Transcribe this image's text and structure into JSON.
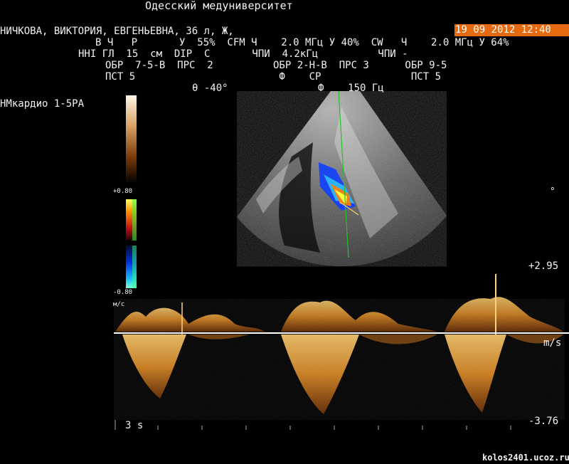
{
  "header": {
    "clinic": "Одесский медуниверситет",
    "patient": "НИЧКОВА, ВИКТОРИЯ, ЕВГЕНЬЕВНА, 36 л, Ж,",
    "datetime": "19 09 2012 12:40"
  },
  "params": {
    "row1": "В Ч   Р       У  55%  CFM Ч    2.0 МГц У 40%  CW   Ч    2.0 МГц У 64%",
    "row2": "HHI ГЛ  15  см  DIP  С       ЧПИ  4.2кГц          ЧПИ -",
    "row3": "ОБР  7-5-В  ПРС  2          ОБР 2-Н-В  ПРС 3      ОБР 9-5",
    "row4": "ПСТ 5                        Ф    СР               ПСТ 5",
    "row5": "θ -40°               Ф    150 Гц"
  },
  "probe": "НМкардио 1-5РА",
  "colorbar": {
    "top_label": "+0.80",
    "bottom_label": "-0.80"
  },
  "doppler": {
    "units_label": "м/с",
    "scale_top": "+2.95",
    "scale_bottom": "-3.76",
    "unit": "m/s",
    "time_marker": "3 s"
  },
  "watermark": "kolos2401.ucoz.ru",
  "colors": {
    "date_bg": "#e86a10",
    "baseline": "#ffffff",
    "needle": "#22c522"
  }
}
